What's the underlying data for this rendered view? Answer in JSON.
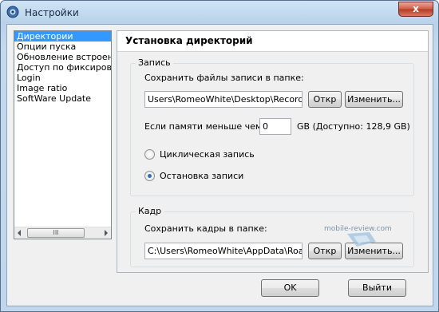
{
  "window": {
    "title": "Настройки",
    "close_label": "x"
  },
  "sidebar": {
    "items": [
      {
        "label": "Директории",
        "selected": true
      },
      {
        "label": "Опции пуска",
        "selected": false
      },
      {
        "label": "Обновление встроенно",
        "selected": false
      },
      {
        "label": "Доступ по фиксирован",
        "selected": false
      },
      {
        "label": "Login",
        "selected": false
      },
      {
        "label": "Image ratio",
        "selected": false
      },
      {
        "label": "SoftWare Update",
        "selected": false
      }
    ],
    "scroll_thumb_label": "III"
  },
  "panel": {
    "title": "Установка директорий",
    "record": {
      "legend": "Запись",
      "save_label": "Сохранить файлы записи в папке:",
      "path_value": "Users\\RomeoWhite\\Desktop\\Recording",
      "open_label": "Откр",
      "change_label": "Изменить...",
      "memory_label": "Если памяти меньше чем",
      "memory_value": "0",
      "memory_suffix": "GB (Доступно: 128,9 GB)",
      "radio_cyclic_label": "Циклическая запись",
      "radio_stop_label": "Остановка записи",
      "selected_mode": "stop"
    },
    "frame": {
      "legend": "Кадр",
      "save_label": "Сохранить кадры в папке:",
      "path_value": "C:\\Users\\RomeoWhite\\AppData\\Roamii",
      "open_label": "Откр",
      "change_label": "Изменить..."
    }
  },
  "footer": {
    "ok_label": "OK",
    "exit_label": "Выйти"
  },
  "watermark": "mobile-review.com",
  "colors": {
    "selection": "#3399ff",
    "close_button": "#c9503b"
  }
}
